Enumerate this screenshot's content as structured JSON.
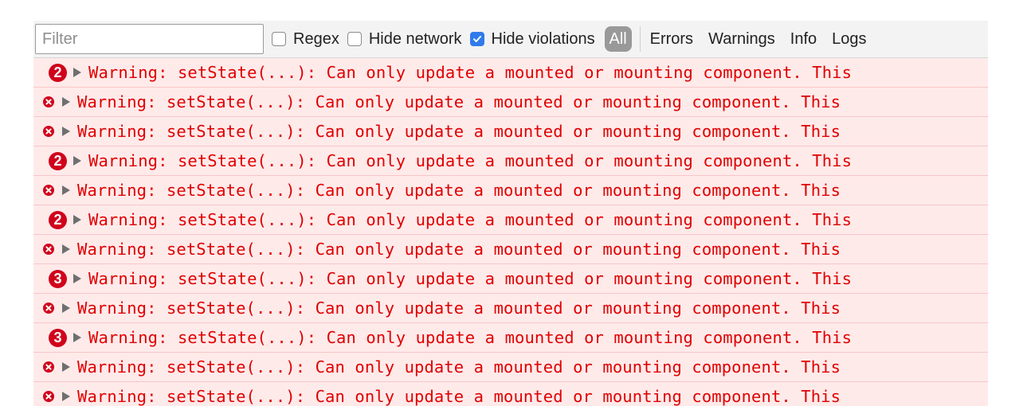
{
  "toolbar": {
    "filter_placeholder": "Filter",
    "regex_label": "Regex",
    "regex_checked": false,
    "hide_network_label": "Hide network",
    "hide_network_checked": false,
    "hide_violations_label": "Hide violations",
    "hide_violations_checked": true,
    "all_label": "All",
    "levels": [
      "Errors",
      "Warnings",
      "Info",
      "Logs"
    ]
  },
  "colors": {
    "error_text": "#e00000",
    "row_background": "#ffeaea",
    "badge": "#d0021b",
    "checkbox_checked": "#2f7bec"
  },
  "log": {
    "rows": [
      {
        "repeat": "2",
        "icon": "error-circle-icon",
        "message": "Warning: setState(...): Can only update a mounted or mounting component. This"
      },
      {
        "repeat": "",
        "icon": "error-circle-icon",
        "message": "Warning: setState(...): Can only update a mounted or mounting component. This"
      },
      {
        "repeat": "",
        "icon": "error-circle-icon",
        "message": "Warning: setState(...): Can only update a mounted or mounting component. This"
      },
      {
        "repeat": "2",
        "icon": "error-circle-icon",
        "message": "Warning: setState(...): Can only update a mounted or mounting component. This"
      },
      {
        "repeat": "",
        "icon": "error-circle-icon",
        "message": "Warning: setState(...): Can only update a mounted or mounting component. This"
      },
      {
        "repeat": "2",
        "icon": "error-circle-icon",
        "message": "Warning: setState(...): Can only update a mounted or mounting component. This"
      },
      {
        "repeat": "",
        "icon": "error-circle-icon",
        "message": "Warning: setState(...): Can only update a mounted or mounting component. This"
      },
      {
        "repeat": "3",
        "icon": "error-circle-icon",
        "message": "Warning: setState(...): Can only update a mounted or mounting component. This"
      },
      {
        "repeat": "",
        "icon": "error-circle-icon",
        "message": "Warning: setState(...): Can only update a mounted or mounting component. This"
      },
      {
        "repeat": "3",
        "icon": "error-circle-icon",
        "message": "Warning: setState(...): Can only update a mounted or mounting component. This"
      },
      {
        "repeat": "",
        "icon": "error-circle-icon",
        "message": "Warning: setState(...): Can only update a mounted or mounting component. This"
      },
      {
        "repeat": "",
        "icon": "error-circle-icon",
        "message": "Warning: setState(...): Can only update a mounted or mounting component. This"
      }
    ]
  }
}
